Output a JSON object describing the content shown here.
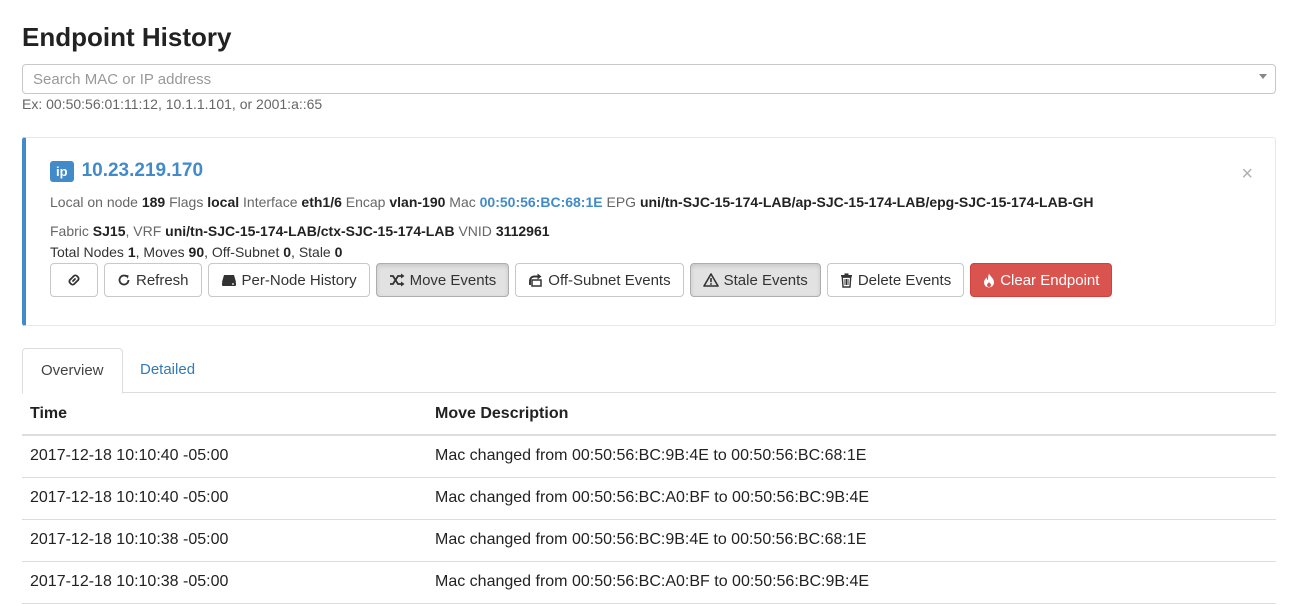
{
  "page": {
    "title": "Endpoint History"
  },
  "search": {
    "placeholder": "Search MAC or IP address",
    "hint": "Ex: 00:50:56:01:11:12, 10.1.1.101, or 2001:a::65"
  },
  "endpoint": {
    "badge": "ip",
    "address": "10.23.219.170",
    "close_symbol": "×",
    "line1": {
      "local_label": "Local on node",
      "node": "189",
      "flags_label": "Flags",
      "flags": "local",
      "interface_label": "Interface",
      "interface": "eth1/6",
      "encap_label": "Encap",
      "encap": "vlan-190",
      "mac_label": "Mac",
      "mac": "00:50:56:BC:68:1E",
      "epg_label": "EPG",
      "epg": "uni/tn-SJC-15-174-LAB/ap-SJC-15-174-LAB/epg-SJC-15-174-LAB-GH"
    },
    "line2": {
      "fabric_label": "Fabric",
      "fabric": "SJ15",
      "vrf_label": "VRF",
      "vrf": "uni/tn-SJC-15-174-LAB/ctx-SJC-15-174-LAB",
      "vnid_label": "VNID",
      "vnid": "3112961"
    },
    "line3": {
      "total_nodes_label": "Total Nodes",
      "total_nodes": "1",
      "moves_label": "Moves",
      "moves": "90",
      "offsubnet_label": "Off-Subnet",
      "offsubnet": "0",
      "stale_label": "Stale",
      "stale": "0"
    }
  },
  "buttons": {
    "link": {
      "icon": "link-icon"
    },
    "refresh": {
      "label": "Refresh",
      "icon": "refresh-icon"
    },
    "per_node_history": {
      "label": "Per-Node History",
      "icon": "hdd-icon"
    },
    "move_events": {
      "label": "Move Events",
      "icon": "random-icon"
    },
    "off_subnet_events": {
      "label": "Off-Subnet Events",
      "icon": "share-icon"
    },
    "stale_events": {
      "label": "Stale Events",
      "icon": "warning-icon"
    },
    "delete_events": {
      "label": "Delete Events",
      "icon": "trash-icon"
    },
    "clear_endpoint": {
      "label": "Clear Endpoint",
      "icon": "fire-icon"
    }
  },
  "tabs": [
    {
      "label": "Overview",
      "active": true
    },
    {
      "label": "Detailed",
      "active": false
    }
  ],
  "table": {
    "headers": {
      "time": "Time",
      "description": "Move Description"
    },
    "rows": [
      {
        "time": "2017-12-18 10:10:40 -05:00",
        "description": "Mac changed from 00:50:56:BC:9B:4E to 00:50:56:BC:68:1E"
      },
      {
        "time": "2017-12-18 10:10:40 -05:00",
        "description": "Mac changed from 00:50:56:BC:A0:BF to 00:50:56:BC:9B:4E"
      },
      {
        "time": "2017-12-18 10:10:38 -05:00",
        "description": "Mac changed from 00:50:56:BC:9B:4E to 00:50:56:BC:68:1E"
      },
      {
        "time": "2017-12-18 10:10:38 -05:00",
        "description": "Mac changed from 00:50:56:BC:A0:BF to 00:50:56:BC:9B:4E"
      }
    ]
  },
  "colors": {
    "primary": "#428bca",
    "danger": "#d9534f",
    "link": "#337ab7"
  }
}
